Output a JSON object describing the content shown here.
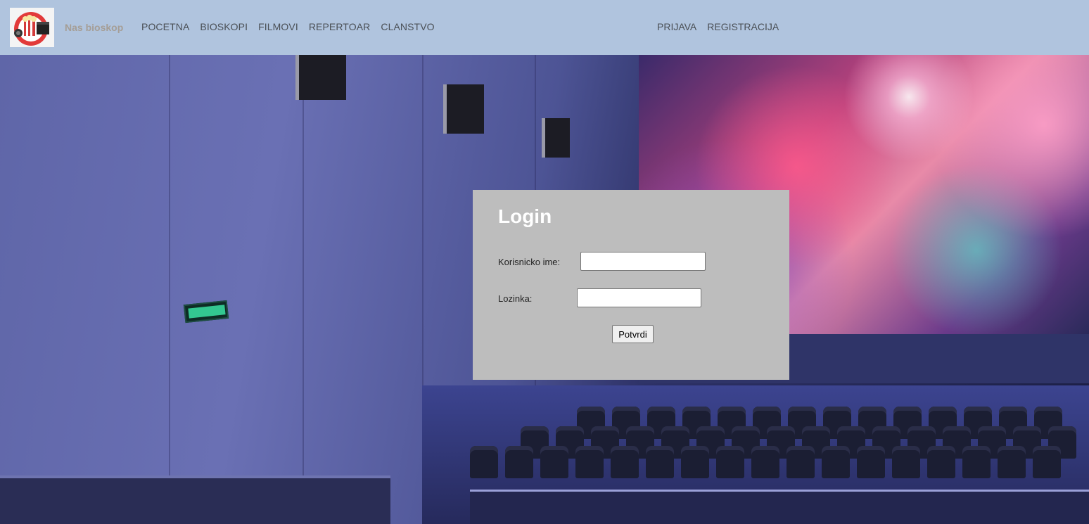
{
  "brand": {
    "name": "Nas bioskop"
  },
  "nav": {
    "left": [
      {
        "label": "POCETNA"
      },
      {
        "label": "BIOSKOPI"
      },
      {
        "label": "FILMOVI"
      },
      {
        "label": "REPERTOAR"
      },
      {
        "label": "CLANSTVO"
      }
    ],
    "right": [
      {
        "label": "PRIJAVA"
      },
      {
        "label": "REGISTRACIJA"
      }
    ]
  },
  "login": {
    "title": "Login",
    "username_label": "Korisnicko ime:",
    "username_value": "",
    "password_label": "Lozinka:",
    "password_value": "",
    "submit_label": "Potvrdi"
  },
  "colors": {
    "navbar_bg": "#b0c4de",
    "login_bg": "#bdbdbd",
    "brand_text": "#a59e96"
  },
  "icons": {
    "logo": "cinema-popcorn-logo-icon"
  }
}
